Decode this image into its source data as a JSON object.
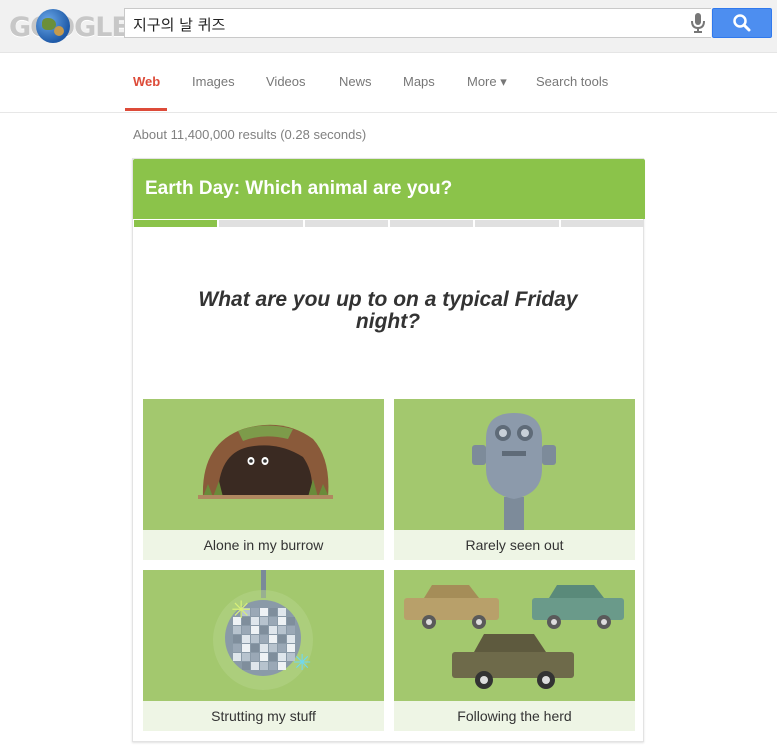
{
  "search": {
    "query": "지구의 날 퀴즈"
  },
  "logo": {
    "text": "GOOGLE"
  },
  "tabs": [
    {
      "label": "Web"
    },
    {
      "label": "Images"
    },
    {
      "label": "Videos"
    },
    {
      "label": "News"
    },
    {
      "label": "Maps"
    },
    {
      "label": "More ▾"
    },
    {
      "label": "Search tools"
    }
  ],
  "results": {
    "stats": "About 11,400,000 results (0.28 seconds)"
  },
  "quiz": {
    "title": "Earth Day: Which animal are you?",
    "progress_total": 6,
    "progress_current": 1,
    "question": "What are you up to on a typical Friday night?",
    "options": [
      {
        "label": "Alone in my burrow"
      },
      {
        "label": "Rarely seen out"
      },
      {
        "label": "Strutting my stuff"
      },
      {
        "label": "Following the herd"
      }
    ]
  },
  "colors": {
    "accent_green": "#8bc34a",
    "active_tab": "#dd4b39",
    "search_button": "#4d8ef0"
  },
  "icons": [
    "microphone-icon",
    "search-icon",
    "earth-globe-icon"
  ]
}
